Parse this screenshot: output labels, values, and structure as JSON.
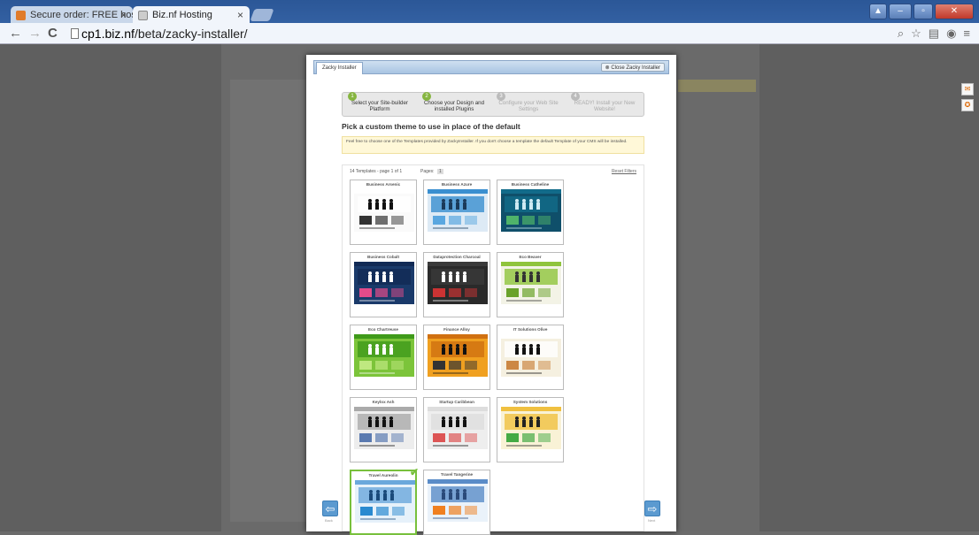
{
  "browser": {
    "tabs": [
      {
        "label": "Secure order: FREE hosting"
      },
      {
        "label": "Biz.nf Hosting"
      }
    ],
    "url_host": "cp1.biz.nf",
    "url_path": "/beta/zacky-installer/"
  },
  "modal": {
    "tab_label": "Zacky Installer",
    "close_label": "Close Zacky Installer",
    "steps": [
      {
        "num": "1",
        "label": "Select your Site-builder Platform",
        "state": "active"
      },
      {
        "num": "2",
        "label": "Choose your Design and installed Plugins",
        "state": "active"
      },
      {
        "num": "3",
        "label": "Configure your Web Site Settings",
        "state": "todo"
      },
      {
        "num": "4",
        "label": "READY! Install your New Website!",
        "state": "todo"
      }
    ],
    "heading": "Pick a custom theme to use in place of the default",
    "note": "Feel free to choose one of the Templates provided by ZackyInstaller. If you don't choose a template the default Template of your CMS will be installed.",
    "gallery_info": "14 Templates - page 1 of 1",
    "pages_label": "Pages:",
    "current_page": "1",
    "reset_label": "Reset Filters",
    "back_label": "Back",
    "next_label": "Next",
    "templates": [
      {
        "name": "Business Arsenic",
        "theme": "white"
      },
      {
        "name": "Business Azure",
        "theme": "azure"
      },
      {
        "name": "Business Catheline",
        "theme": "teal"
      },
      {
        "name": "Business Cobalt",
        "theme": "cobalt"
      },
      {
        "name": "Dataprotection Charcoal",
        "theme": "charcoal"
      },
      {
        "name": "Eco Beaver",
        "theme": "eco"
      },
      {
        "name": "Eco Chartreuse",
        "theme": "green"
      },
      {
        "name": "Finance Alloy",
        "theme": "orange"
      },
      {
        "name": "IT Solutions Olive",
        "theme": "olive"
      },
      {
        "name": "Keylox Ash",
        "theme": "ash"
      },
      {
        "name": "Startup Caribbean",
        "theme": "caribbean"
      },
      {
        "name": "System Solutions",
        "theme": "system"
      },
      {
        "name": "Travel Aureolin",
        "theme": "travel",
        "selected": true
      },
      {
        "name": "Travel Tangerine",
        "theme": "tangerine"
      }
    ]
  },
  "colors": {
    "accent_green": "#78c03c",
    "link_blue": "#5b9ad0"
  }
}
